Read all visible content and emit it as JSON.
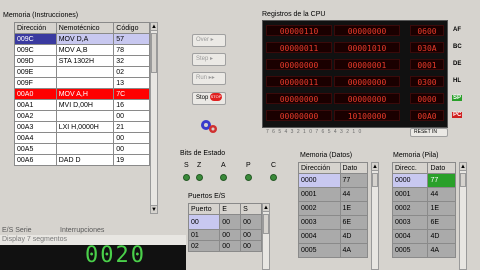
{
  "memory_instr": {
    "title": "Memoria (Instrucciones)",
    "headers": [
      "Dirección",
      "Nemotécnico",
      "Código"
    ],
    "rows": [
      [
        "009C",
        "MOV D,A",
        "57"
      ],
      [
        "009C",
        "MOV A,B",
        "78"
      ],
      [
        "009D",
        "STA 1302H",
        "32"
      ],
      [
        "009E",
        "",
        "02"
      ],
      [
        "009F",
        "",
        "13"
      ],
      [
        "00A0",
        "MOV A,H",
        "7C"
      ],
      [
        "00A1",
        "MVI D,00H",
        "16"
      ],
      [
        "00A2",
        "",
        "00"
      ],
      [
        "00A3",
        "LXI H,0000H",
        "21"
      ],
      [
        "00A4",
        "",
        "00"
      ],
      [
        "00A5",
        "",
        "00"
      ],
      [
        "00A6",
        "DAD D",
        "19"
      ]
    ]
  },
  "controls": {
    "step_label": "Over",
    "step_into_label": "Step",
    "run_label": "Run",
    "stop_label": "Stop",
    "stop_badge": "STOP"
  },
  "cpu": {
    "title": "Registros de la CPU",
    "registers": [
      {
        "name": "AF",
        "high": "00000110",
        "low": "00000000",
        "hex": "0600"
      },
      {
        "name": "BC",
        "high": "00000011",
        "low": "00001010",
        "hex": "030A"
      },
      {
        "name": "DE",
        "high": "00000000",
        "low": "00000001",
        "hex": "0001"
      },
      {
        "name": "HL",
        "high": "00000011",
        "low": "00000000",
        "hex": "0300"
      },
      {
        "name": "SP",
        "high": "00000000",
        "low": "00000000",
        "hex": "0000"
      },
      {
        "name": "PC",
        "high": "00000000",
        "low": "10100000",
        "hex": "00A0"
      }
    ],
    "reset_label": "RESET IN",
    "bit_index": "7 6 5 4 3 2 1 0 7 6 5 4 3 2 1 0"
  },
  "flags": {
    "title": "Bits de Estado",
    "labels": [
      "S",
      "Z",
      "A",
      "P",
      "C"
    ]
  },
  "ports": {
    "title": "Puertos E/S",
    "headers": [
      "Puerto",
      "E",
      "S"
    ],
    "rows": [
      [
        "00",
        "00",
        "00"
      ],
      [
        "01",
        "00",
        "00"
      ],
      [
        "02",
        "00",
        "00"
      ]
    ]
  },
  "memory_data": {
    "title": "Memoria (Datos)",
    "headers": [
      "Dirección",
      "Dato"
    ],
    "rows": [
      [
        "0000",
        "77"
      ],
      [
        "0001",
        "44"
      ],
      [
        "0002",
        "1E"
      ],
      [
        "0003",
        "6E"
      ],
      [
        "0004",
        "4D"
      ],
      [
        "0005",
        "4A"
      ]
    ]
  },
  "memory_stack": {
    "title": "Memoria (Pila)",
    "headers": [
      "Direcc.",
      "Dato"
    ],
    "rows": [
      [
        "0000",
        "77"
      ],
      [
        "0001",
        "44"
      ],
      [
        "0002",
        "1E"
      ],
      [
        "0003",
        "6E"
      ],
      [
        "0004",
        "4D"
      ],
      [
        "0005",
        "4A"
      ]
    ]
  },
  "bottom": {
    "es_serie": "E/S Serie",
    "interrupciones": "Interrupciones",
    "display_title": "Display 7 segmentos",
    "display_value": "0020"
  },
  "colors": {
    "selected_row": "#c8c8f0",
    "current_row": "#ff0000",
    "led_green": "#3a8a3a",
    "digit_red": "#e83a2a",
    "stack_highlight": "#2aa02a"
  }
}
